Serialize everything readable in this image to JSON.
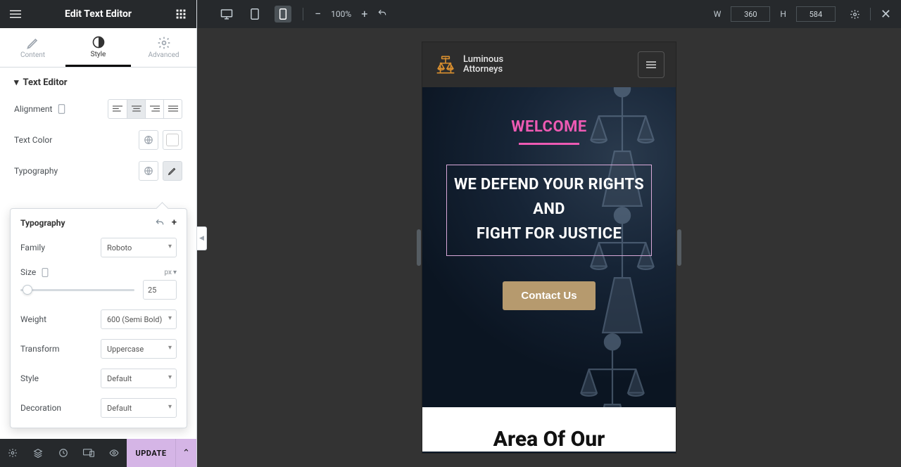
{
  "panel": {
    "title": "Edit Text Editor",
    "tabs": {
      "content": "Content",
      "style": "Style",
      "advanced": "Advanced",
      "active": "style"
    },
    "section_title": "Text Editor",
    "alignment_label": "Alignment",
    "alignment_active": "center",
    "text_color_label": "Text Color",
    "typography_label": "Typography",
    "update_label": "UPDATE"
  },
  "popover": {
    "title": "Typography",
    "family_label": "Family",
    "family_value": "Roboto",
    "size_label": "Size",
    "size_unit": "px",
    "size_value": "25",
    "weight_label": "Weight",
    "weight_value": "600 (Semi Bold)",
    "transform_label": "Transform",
    "transform_value": "Uppercase",
    "style_label": "Style",
    "style_value": "Default",
    "decoration_label": "Decoration",
    "decoration_value": "Default"
  },
  "topbar": {
    "zoom": "100%",
    "w_label": "W",
    "h_label": "H",
    "width": "360",
    "height": "584"
  },
  "preview": {
    "logo_line1": "Luminous",
    "logo_line2": "Attorneys",
    "welcome": "WELCOME",
    "hero_line1": "WE DEFEND YOUR RIGHTS",
    "hero_line2": "AND",
    "hero_line3": "FIGHT FOR JUSTICE",
    "cta": "Contact Us",
    "section2_title": "Area Of Our"
  }
}
